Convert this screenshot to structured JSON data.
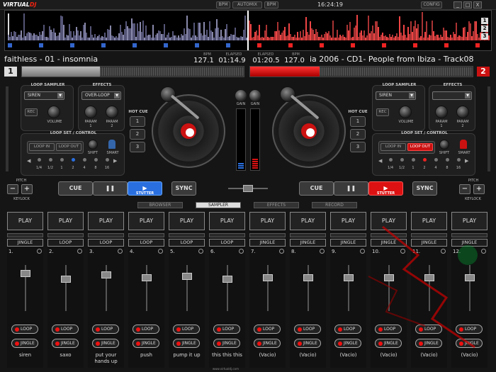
{
  "app": {
    "logo_prefix": "VIRTUAL",
    "logo_suffix": "DJ",
    "clock": "16:24:19",
    "footer": "www.virtualdj.com"
  },
  "topbar": {
    "bpm1": "BPM",
    "automix": "AUTOMIX",
    "bpm2": "BPM",
    "config": "CONFIG",
    "minimize": "_",
    "maximize": "□",
    "close": "X"
  },
  "waveform": {
    "numbers": [
      "1",
      "2",
      "3"
    ]
  },
  "deck1": {
    "number": "1",
    "title": "faithless - 01 - insomnia",
    "bpm_label": "BPM",
    "bpm": "127.1",
    "elapsed_label": "ELAPSED",
    "elapsed": "01:14.9"
  },
  "deck2": {
    "number": "2",
    "title": "ia 2006 - CD1- People from Ibiza - Track08",
    "bpm_label": "BPM",
    "bpm": "127.0",
    "elapsed_label": "ELAPSED",
    "elapsed": "01:20.5"
  },
  "left": {
    "loop_sampler": "LOOP SAMPLER",
    "sample": "SIREN",
    "rec": "REC",
    "volume": "VOLUME",
    "effects": "EFFECTS",
    "effect": "OVER-LOOP",
    "param1": "PARAM\n1",
    "param2": "PARAM\n2",
    "loop_set": "LOOP SET / CONTROL",
    "loop_in": "LOOP IN",
    "loop_out": "LOOP OUT",
    "shift": "SHIFT",
    "smart": "SMART",
    "lengths": [
      "1/4",
      "1/2",
      "1",
      "2",
      "4",
      "8",
      "16"
    ],
    "hot_cue": "HOT CUE",
    "hc": [
      "1",
      "2",
      "3"
    ],
    "cue": "CUE",
    "play": "❚❚",
    "stutter": "STUTTER",
    "sync": "SYNC",
    "pitch": "PITCH",
    "keylock": "KEYLOCK"
  },
  "right": {
    "loop_sampler": "LOOP SAMPLER",
    "sample": "SIREN",
    "rec": "REC",
    "volume": "VOLUME",
    "effects": "EFFECTS",
    "effect": "",
    "param1": "PARAM\n1",
    "param2": "PARAM\n2",
    "loop_set": "LOOP SET / CONTROL",
    "loop_in": "LOOP IN",
    "loop_out": "LOOP OUT",
    "shift": "SHIFT",
    "smart": "SMART",
    "lengths": [
      "1/4",
      "1/2",
      "1",
      "2",
      "4",
      "8",
      "16"
    ],
    "hot_cue": "HOT CUE",
    "hc": [
      "1",
      "2",
      "3"
    ],
    "cue": "CUE",
    "play": "❚❚",
    "stutter": "STUTTER",
    "sync": "SYNC",
    "pitch": "PITCH",
    "keylock": "KEYLOCK"
  },
  "mixer": {
    "gain_left": "GAIN",
    "gain_right": "GAIN"
  },
  "tabs": [
    "BROWSER",
    "SAMPLER",
    "EFFECTS",
    "RECORD"
  ],
  "sampler": {
    "play": "PLAY",
    "loop_label": "LOOP",
    "jingle_label": "JINGLE",
    "slots": [
      {
        "num": "1.",
        "mode": "JINGLE",
        "name": "siren"
      },
      {
        "num": "2.",
        "mode": "LOOP",
        "name": "saxo"
      },
      {
        "num": "3.",
        "mode": "LOOP",
        "name": "put your hands up"
      },
      {
        "num": "4.",
        "mode": "LOOP",
        "name": "push"
      },
      {
        "num": "5.",
        "mode": "LOOP",
        "name": "pump it up"
      },
      {
        "num": "6.",
        "mode": "LOOP",
        "name": "this this this"
      },
      {
        "num": "7.",
        "mode": "JINGLE",
        "name": "(Vacio)"
      },
      {
        "num": "8.",
        "mode": "JINGLE",
        "name": "(Vacio)"
      },
      {
        "num": "9.",
        "mode": "JINGLE",
        "name": "(Vacio)"
      },
      {
        "num": "10.",
        "mode": "JINGLE",
        "name": "(Vacio)"
      },
      {
        "num": "11.",
        "mode": "JINGLE",
        "name": "(Vacio)"
      },
      {
        "num": "12.",
        "mode": "JINGLE",
        "name": "(Vacio)"
      }
    ]
  },
  "colors": {
    "accent_red": "#d11",
    "accent_blue": "#2a6fe0"
  }
}
